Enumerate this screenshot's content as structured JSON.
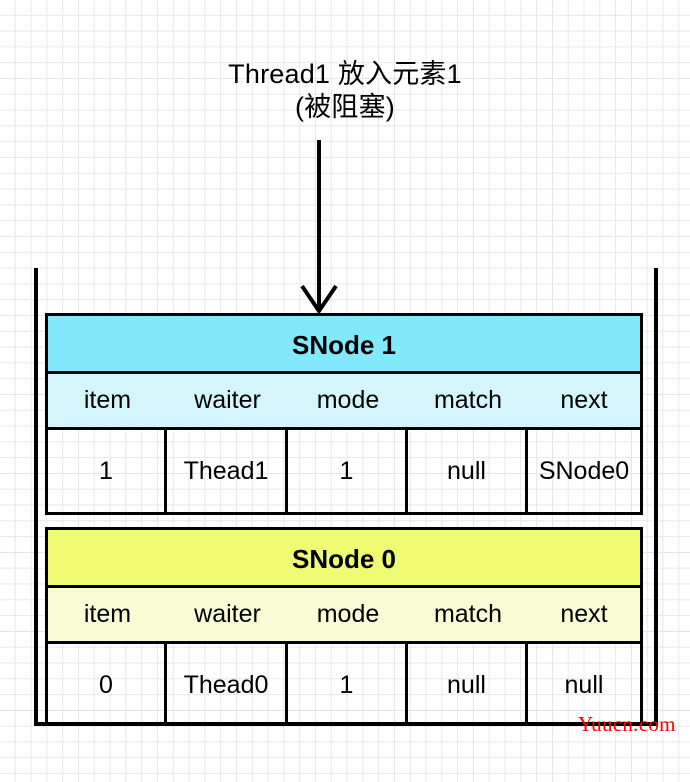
{
  "diagram": {
    "title_lines": [
      "Thread1 放入元素1",
      "(被阻塞)"
    ],
    "arrow": {
      "name": "downward-arrow",
      "direction": "down"
    },
    "watermark": "Yuucn.com",
    "colors": {
      "node1_header": "#82e9fc",
      "node1_fields": "#d4f5fc",
      "node0_header": "#eefb73",
      "node0_fields": "#f8fcd4",
      "stroke": "#000000",
      "watermark": "#ff0000",
      "grid_minor": "#e8e8e8",
      "grid_major": "#c9c9c9"
    },
    "columns": [
      "item",
      "waiter",
      "mode",
      "match",
      "next"
    ],
    "nodes": [
      {
        "id": "snode-1",
        "title": "SNode 1",
        "fields": [
          "item",
          "waiter",
          "mode",
          "match",
          "next"
        ],
        "values": [
          "1",
          "Thead1",
          "1",
          "null",
          "SNode0"
        ]
      },
      {
        "id": "snode-0",
        "title": "SNode 0",
        "fields": [
          "item",
          "waiter",
          "mode",
          "match",
          "next"
        ],
        "values": [
          "0",
          "Thead0",
          "1",
          "null",
          "null"
        ]
      }
    ]
  }
}
